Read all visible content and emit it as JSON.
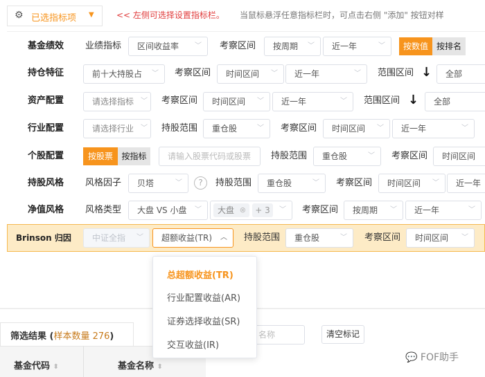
{
  "header": {
    "selected_button": "已选指标项",
    "hint_red": "<< 左侧可选择设置指标栏。",
    "hint_gray": "当鼠标悬浮任意指标栏时，可点击右侧 \"添加\" 按钮对样"
  },
  "rows": {
    "perf": {
      "title": "基金绩效",
      "metric_label": "业绩指标",
      "metric": "区间收益率",
      "period_label": "考察区间",
      "period_type": "按周期",
      "period": "近一年",
      "toggle_on": "按数值",
      "toggle_off": "按排名"
    },
    "holding": {
      "title": "持仓特征",
      "metric": "前十大持股占",
      "period_label": "考察区间",
      "period_type": "时间区间",
      "period": "近一年",
      "range_label": "范围区间",
      "range": "全部"
    },
    "asset": {
      "title": "资产配置",
      "metric": "请选择指标",
      "period_label": "考察区间",
      "period_type": "时间区间",
      "period": "近一年",
      "range_label": "范围区间",
      "range": "全部"
    },
    "industry": {
      "title": "行业配置",
      "metric": "请选择行业",
      "scope_label": "持股范围",
      "scope": "重仓股",
      "period_label": "考察区间",
      "period_type": "时间区间",
      "period": "近一年"
    },
    "stock": {
      "title": "个股配置",
      "toggle_on": "按股票",
      "toggle_off": "按指标",
      "input_placeholder": "请输入股票代码或股票",
      "scope_label": "持股范围",
      "scope": "重仓股",
      "period_label": "考察区间",
      "period_type": "时间区间"
    },
    "style": {
      "title": "持股风格",
      "factor_label": "风格因子",
      "factor": "贝塔",
      "help": "?",
      "scope_label": "持股范围",
      "scope": "重仓股",
      "period_label": "考察区间",
      "period_type": "时间区间",
      "period": "近一年"
    },
    "nav": {
      "title": "净值风格",
      "type_label": "风格类型",
      "type": "大盘 VS 小盘",
      "tag": "大盘",
      "tag_more": "+ 3",
      "period_label": "考察区间",
      "period_type": "按周期",
      "period": "近一年"
    },
    "brinson": {
      "title": "Brinson 归因",
      "index": "中证全指",
      "metric": "超额收益(TR)",
      "scope_label": "持股范围",
      "scope": "重仓股",
      "period_label": "考察区间",
      "period_type": "时间区间"
    }
  },
  "dropdown": {
    "items": [
      "总超额收益(TR)",
      "行业配置收益(AR)",
      "证券选择收益(SR)",
      "交互收益(IR)"
    ],
    "selected": 0
  },
  "results": {
    "tab_label": "筛选结果 (",
    "sample_label": "样本数量 276",
    "tab_close": ")",
    "search_placeholder": "名称",
    "clear_button": "清空标记",
    "columns": [
      "基金代码",
      "基金名称"
    ]
  },
  "watermark": "FOF助手",
  "colors": {
    "accent": "#f7941d",
    "hint_red": "#e03c3c",
    "band": "#fdebc6"
  }
}
